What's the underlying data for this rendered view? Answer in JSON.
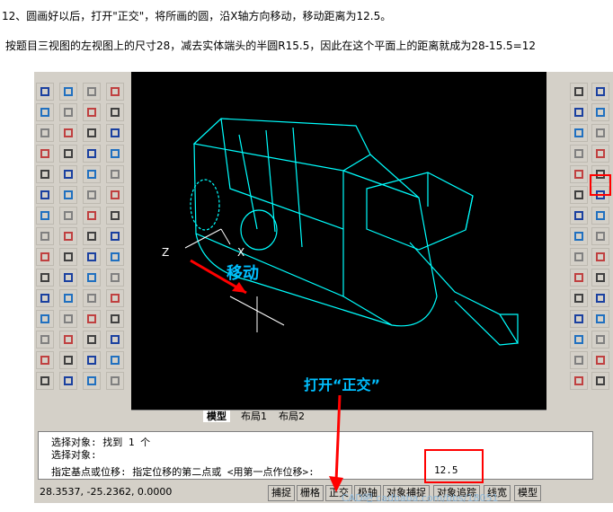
{
  "article": {
    "step_line": "12、圆画好以后，打开\"正交\"，将所画的圆，沿X轴方向移动，移动距离为12.5。",
    "explain_line": "按题目三视图的左视图上的尺寸28，减去实体端头的半圆R15.5，因此在这个平面上的距离就成为28-15.5=12"
  },
  "canvas": {
    "annotation_move": "移动",
    "annotation_ortho": "打开“正交”",
    "ucs_z": "Z",
    "ucs_x": "X"
  },
  "layout_tabs": [
    "模型",
    "布局1",
    "布局2"
  ],
  "command_window": {
    "line1": "选择对象: 找到 1 个",
    "line2": "选择对象:",
    "line3": "指定基点或位移: 指定位移的第二点或 <用第一点作位移>:",
    "input_value": "12.5"
  },
  "status_bar": {
    "coordinates": "28.3537,  -25.2362, 0.0000",
    "buttons": [
      "捕捉",
      "栅格",
      "正交",
      "极轴",
      "对象捕捉",
      "对象追踪",
      "线宽",
      "模型"
    ]
  },
  "watermark": "CAD吧 cadbaba.com/bbs/18051",
  "colors": {
    "wireframe": "#00ffff",
    "annotation": "#00bfff",
    "highlight": "#ff0000"
  }
}
